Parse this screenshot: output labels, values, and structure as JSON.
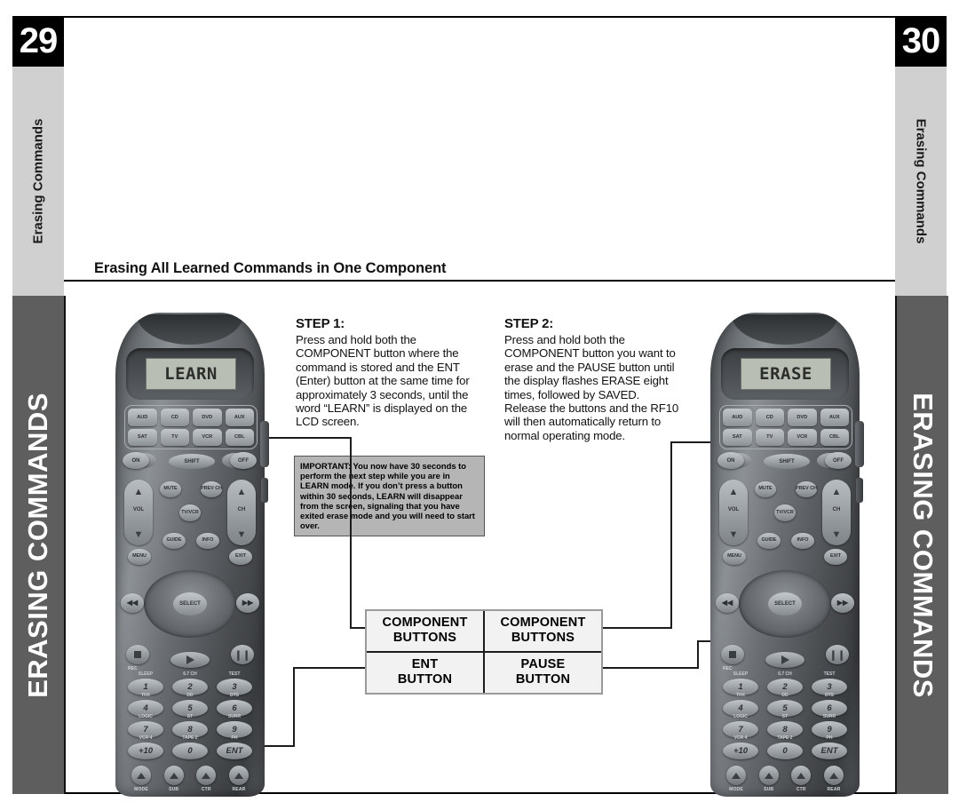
{
  "page": {
    "left_page_number": "29",
    "right_page_number": "30",
    "left_tab_label": "Erasing Commands",
    "right_tab_label": "Erasing Commands",
    "left_vertical_title": "ERASING COMMANDS",
    "right_vertical_title": "ERASING COMMANDS",
    "heading": "Erasing All Learned Commands in One Component"
  },
  "steps": [
    {
      "title": "STEP 1:",
      "body": "Press and hold both the COMPONENT button where the command is stored and the ENT (Enter) button at the same time for approximately 3 seconds, until the word “LEARN” is displayed on the LCD screen."
    },
    {
      "title": "STEP 2:",
      "body": "Press and hold both the COMPONENT button you want to erase and the PAUSE button until the display flashes ERASE eight times, followed by SAVED. Release the buttons and the RF10 will then automatically return to normal operating mode."
    }
  ],
  "important_note": "IMPORTANT: You now have 30 seconds to perform the next step while you are in LEARN mode.  If you don’t press a button within 30 seconds, LEARN will disappear from the screen, signaling that you have exited erase mode and you will need to start over.",
  "callouts": {
    "row1": [
      {
        "line1": "COMPONENT",
        "line2": "BUTTONS"
      },
      {
        "line1": "COMPONENT",
        "line2": "BUTTONS"
      }
    ],
    "row2": [
      {
        "line1": "ENT",
        "line2": "BUTTON"
      },
      {
        "line1": "PAUSE",
        "line2": "BUTTON"
      }
    ]
  },
  "remotes": [
    {
      "id": "left",
      "lcd_text": "LEARN"
    },
    {
      "id": "right",
      "lcd_text": "ERASE"
    }
  ],
  "remote_keys": {
    "component_buttons": [
      "AUD",
      "CD",
      "DVD",
      "AUX",
      "SAT",
      "TV",
      "VCR",
      "CBL"
    ],
    "power_row": {
      "on": "ON",
      "shift": "SHIFT",
      "off": "OFF"
    },
    "volume_label": "VOL",
    "channel_label": "CH",
    "mute": "MUTE",
    "prev_ch": "PREV CH",
    "tv_vcr": "TV/VCR",
    "guide": "GUIDE",
    "info": "INFO",
    "menu": "MENU",
    "exit": "EXIT",
    "select": "SELECT",
    "rec_label": "REC",
    "numbers": [
      {
        "secondary": "SLEEP",
        "digit": "1"
      },
      {
        "secondary": "6.7 CH",
        "digit": "2"
      },
      {
        "secondary": "TEST",
        "digit": "3"
      },
      {
        "secondary": "THX",
        "digit": "4"
      },
      {
        "secondary": "DD",
        "digit": "5"
      },
      {
        "secondary": "DTS",
        "digit": "6"
      },
      {
        "secondary": "LOGIC",
        "digit": "7"
      },
      {
        "secondary": "ST",
        "digit": "8"
      },
      {
        "secondary": "SURR",
        "digit": "9"
      },
      {
        "secondary": "VCR 4",
        "digit": "+10"
      },
      {
        "secondary": "TAPE 2",
        "digit": "0"
      },
      {
        "secondary": "PH",
        "digit": "ENT"
      }
    ],
    "bottom_row": [
      "MODE",
      "SUB",
      "CTR",
      "REAR"
    ]
  },
  "colors": {
    "tab_black": "#000000",
    "tab_gray": "#d0d0d0",
    "bar_gray": "#5e5e5e",
    "important_bg": "#b5b5b5",
    "callout_bg": "#f2f2f2",
    "lcd_bg": "#b9beb4"
  }
}
